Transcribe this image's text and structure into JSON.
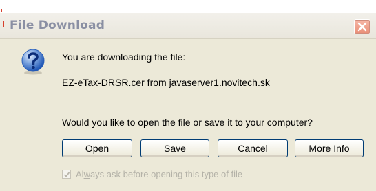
{
  "window": {
    "title": "File Download",
    "close_icon": "close-icon"
  },
  "message": {
    "line1": "You are downloading the file:",
    "file_line": "EZ-eTax-DRSR.cer from javaserver1.novitech.sk",
    "question": "Would you like to open the file or save it to your computer?",
    "icon": "question-icon"
  },
  "buttons": {
    "open": {
      "pre": "",
      "accel": "O",
      "post": "pen"
    },
    "save": {
      "pre": "",
      "accel": "S",
      "post": "ave"
    },
    "cancel": {
      "label": "Cancel"
    },
    "more_info": {
      "pre": "",
      "accel": "M",
      "post": "ore Info"
    }
  },
  "checkbox": {
    "checked": true,
    "pre": "Al",
    "accel": "w",
    "post": "ays ask before opening this type of file",
    "disabled": true
  },
  "colors": {
    "dialog_bg": "#ece9d8",
    "title_text": "#8a8fa3",
    "button_border": "#003c74",
    "close_button": "#e98e76"
  }
}
